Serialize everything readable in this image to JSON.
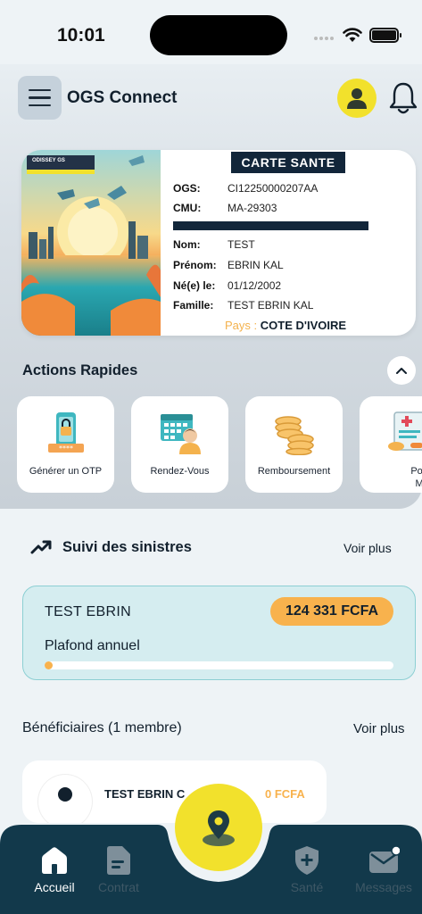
{
  "status_bar": {
    "time": "10:01"
  },
  "header": {
    "title": "OGS Connect"
  },
  "card": {
    "brand": "ODISSEY GS",
    "art_text": "ODISSEY GS",
    "header_title": "CARTE SANTE",
    "ogs": {
      "label": "OGS:",
      "value": "CI12250000207AA"
    },
    "cmu": {
      "label": "CMU:",
      "value": "MA-29303"
    },
    "nom": {
      "label": "Nom:",
      "value": "TEST"
    },
    "prenom": {
      "label": "Prénom:",
      "value": "EBRIN KAL"
    },
    "naissance": {
      "label": "Né(e) le:",
      "value": "01/12/2002"
    },
    "famille": {
      "label": "Famille:",
      "value": "TEST EBRIN KAL"
    },
    "pays": {
      "label": "Pays :",
      "value": "COTE D'IVOIRE"
    }
  },
  "actions": {
    "title": "Actions Rapides",
    "items": [
      {
        "label": "Générer un OTP",
        "icon": "phone-lock-icon"
      },
      {
        "label": "Rendez-Vous",
        "icon": "calendar-doctor-icon"
      },
      {
        "label": "Remboursement",
        "icon": "coins-icon"
      },
      {
        "label": "Posologie",
        "label2": "Médical",
        "icon": "prescription-icon"
      }
    ]
  },
  "sinistres": {
    "title": "Suivi des sinistres",
    "voir_plus": "Voir plus",
    "card": {
      "name": "TEST EBRIN",
      "amount": "124 331 FCFA",
      "plafond_label": "Plafond annuel",
      "progress": 0.02
    }
  },
  "beneficiaires": {
    "title": "Bénéficiaires (1 membre)",
    "voir_plus": "Voir plus",
    "items": [
      {
        "name": "TEST EBRIN C",
        "amount": "0 FCFA"
      }
    ]
  },
  "nav": {
    "items": [
      {
        "label": "Accueil",
        "icon": "home-icon",
        "active": true
      },
      {
        "label": "Contrat",
        "icon": "document-icon",
        "active": false
      },
      {
        "label": "Santé",
        "icon": "shield-plus-icon",
        "active": false
      },
      {
        "label": "Messages",
        "icon": "mail-icon",
        "active": false
      }
    ]
  },
  "colors": {
    "accent_yellow": "#f2e12c",
    "accent_orange": "#f8b24d",
    "navy": "#12263a",
    "teal_card": "#d5edf0"
  }
}
